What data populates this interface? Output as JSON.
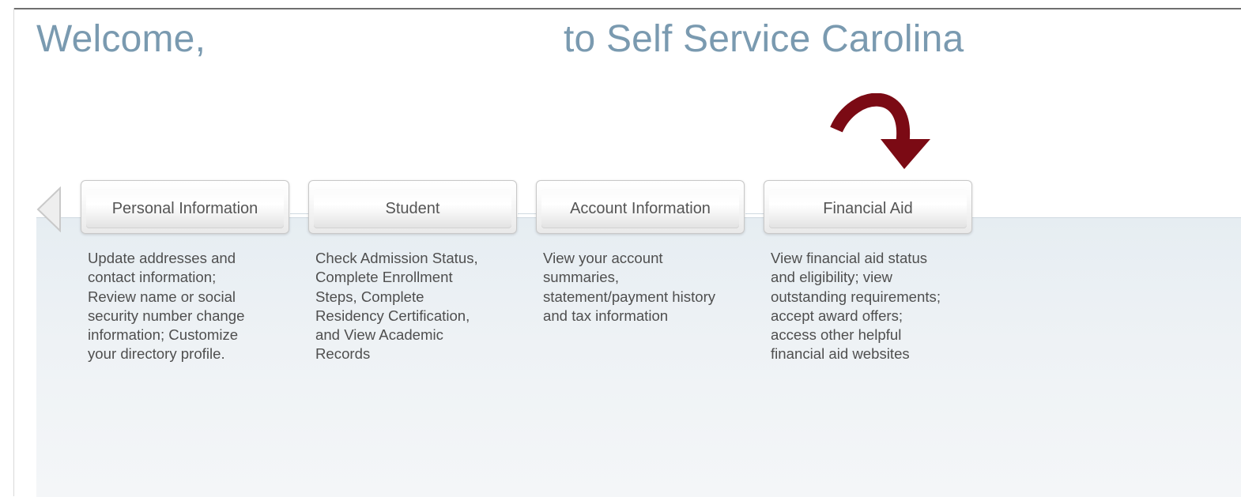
{
  "header": {
    "welcome_prefix": "Welcome,",
    "welcome_suffix": "to Self Service Carolina"
  },
  "colors": {
    "title": "#7a9ab0",
    "arrow": "#7b0a14",
    "panel": "#e6edf2"
  },
  "icons": {
    "left_nav": "left-triangle-icon",
    "highlight": "curved-arrow-down-icon"
  },
  "tabs": [
    {
      "label": "Personal Information",
      "description_lines": [
        "Update addresses and",
        "contact information;",
        "Review name or social",
        "security number change",
        "information; Customize",
        "your directory profile."
      ]
    },
    {
      "label": "Student",
      "description_lines": [
        "Check Admission Status,",
        "Complete Enrollment",
        "Steps, Complete",
        "Residency Certification,",
        "and View Academic",
        "Records"
      ]
    },
    {
      "label": "Account Information",
      "description_lines": [
        "View your account",
        "summaries,",
        "statement/payment history",
        "and tax information"
      ]
    },
    {
      "label": "Financial Aid",
      "description_lines": [
        "View financial aid status",
        "and eligibility; view",
        "outstanding requirements;",
        "accept award offers;",
        "access other helpful",
        "financial aid websites"
      ]
    }
  ]
}
